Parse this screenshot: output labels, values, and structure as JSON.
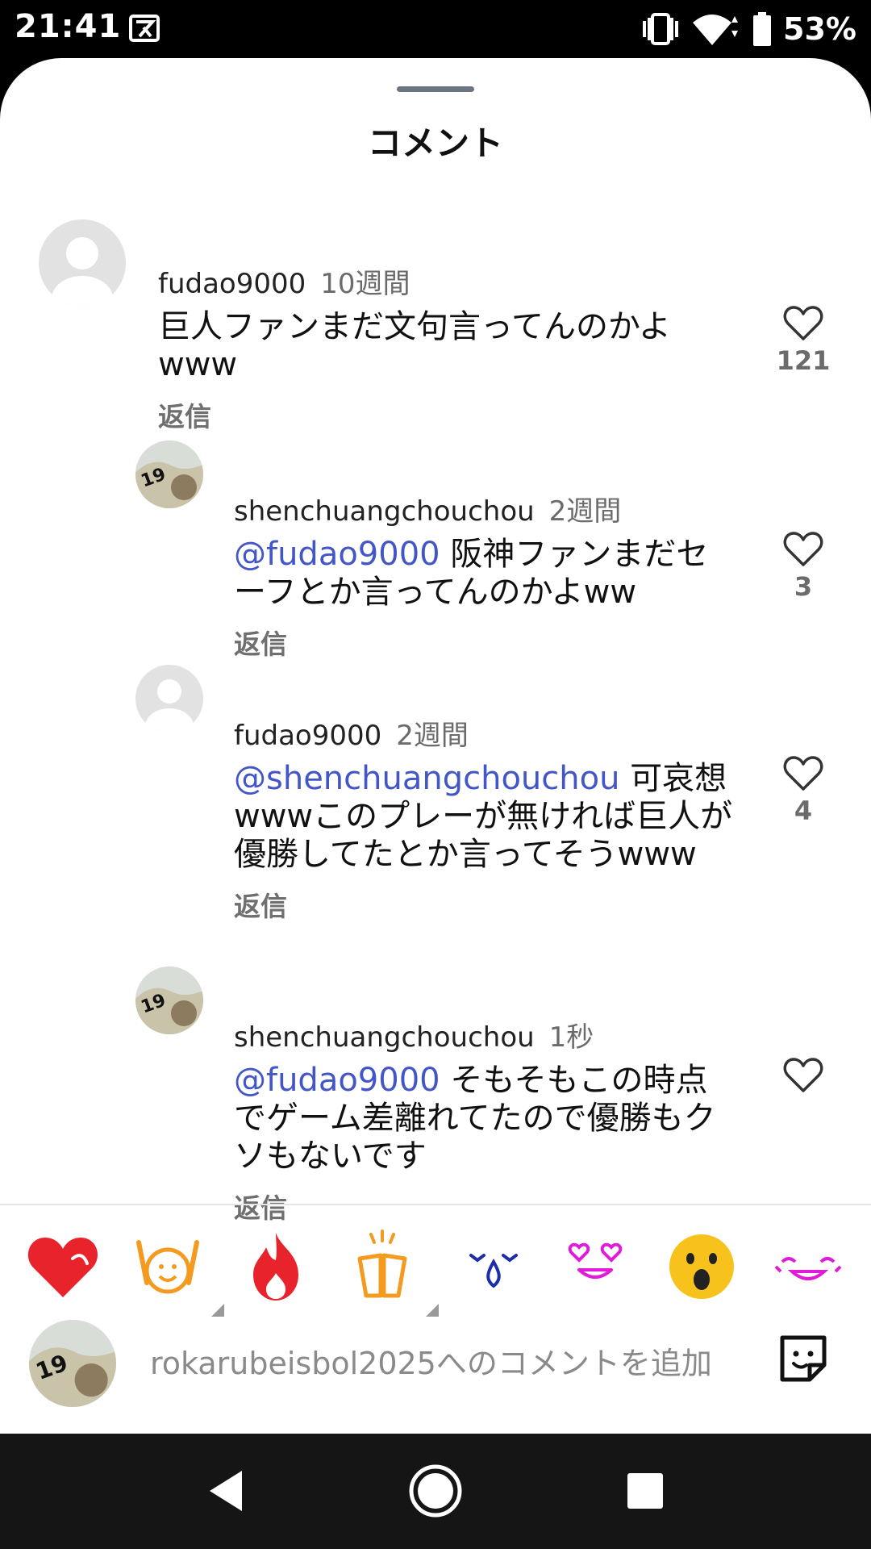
{
  "status_bar": {
    "time": "21:41",
    "battery": "53%",
    "icons": [
      "vibrate-icon",
      "wifi-icon",
      "battery-icon"
    ]
  },
  "sheet": {
    "title": "コメント"
  },
  "comments": [
    {
      "username": "fudao9000",
      "time": "10週間",
      "mention": "",
      "text": "巨人ファンまだ文句言ってんのかよwww",
      "reply_label": "返信",
      "likes": "121"
    },
    {
      "username": "shenchuangchouchou",
      "time": "2週間",
      "mention": "@fudao9000",
      "text": " 阪神ファンまだセーフとか言ってんのかよww",
      "reply_label": "返信",
      "likes": "3"
    },
    {
      "username": "fudao9000",
      "time": "2週間",
      "mention": "@shenchuangchouchou",
      "text": " 可哀想wwwこのプレーが無ければ巨人が優勝してたとか言ってそうwww",
      "reply_label": "返信",
      "likes": "4"
    },
    {
      "username": "shenchuangchouchou",
      "time": "1秒",
      "mention": "@fudao9000",
      "text": " そもそもこの時点でゲーム差離れてたので優勝もクソもないです",
      "reply_label": "返信",
      "likes": ""
    }
  ],
  "reactions": [
    "red-heart-icon",
    "raised-hands-face-icon",
    "fire-icon",
    "clapping-hands-icon",
    "crying-face-icon",
    "heart-eyes-face-icon",
    "surprised-face-icon",
    "laughing-face-icon"
  ],
  "composer": {
    "placeholder": "rokarubeisbol2025へのコメントを追加"
  },
  "colors": {
    "mention": "#4256c8",
    "background": "#ffffff",
    "nav_bar": "#151515"
  }
}
